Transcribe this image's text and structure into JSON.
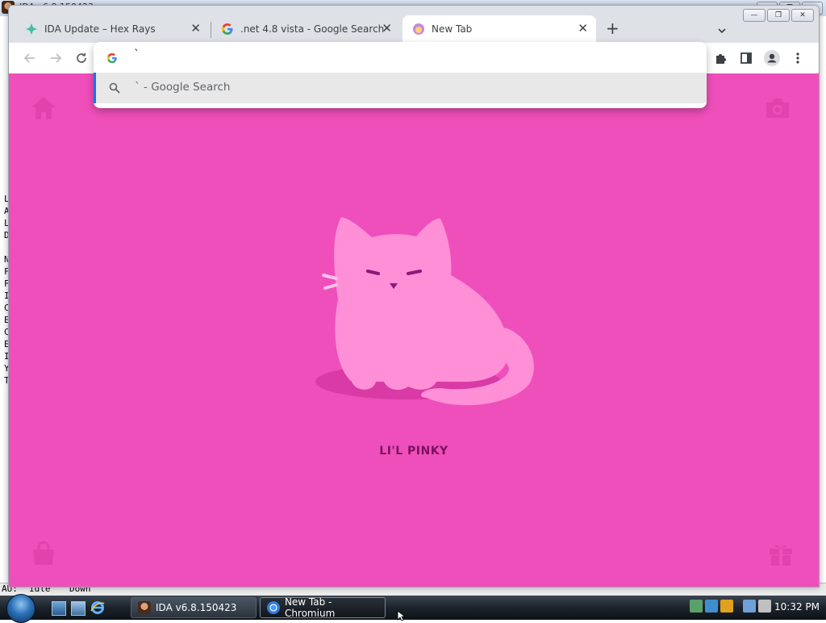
{
  "ida": {
    "title": "IDA v6.8.150423",
    "left_chars": [
      "L",
      "A",
      "L",
      "D",
      "N",
      "F",
      "F",
      "I",
      "C",
      "E",
      "C",
      "E",
      "I",
      "Y",
      "T"
    ],
    "status": {
      "au_label": "AU:",
      "au_state": "idle",
      "direction": "Down"
    }
  },
  "browser": {
    "tabs": [
      {
        "title": "IDA Update – Hex Rays",
        "icon": "hexrays-icon"
      },
      {
        "title": ".net 4.8 vista - Google Search",
        "icon": "google-icon"
      },
      {
        "title": "New Tab",
        "icon": "cat-icon",
        "active": true
      }
    ],
    "omnibox": {
      "text": "`",
      "suggestion": "` - Google Search"
    }
  },
  "ntp": {
    "pet_name": "LI'L PINKY",
    "colors": {
      "background": "#ef4fba",
      "cat": "#ff8fd6",
      "shadow": "#d93aa5"
    }
  },
  "taskbar": {
    "buttons": [
      {
        "label": "IDA v6.8.150423"
      },
      {
        "label": "New Tab - Chromium",
        "active": true
      }
    ],
    "clock": "10:32 PM"
  }
}
